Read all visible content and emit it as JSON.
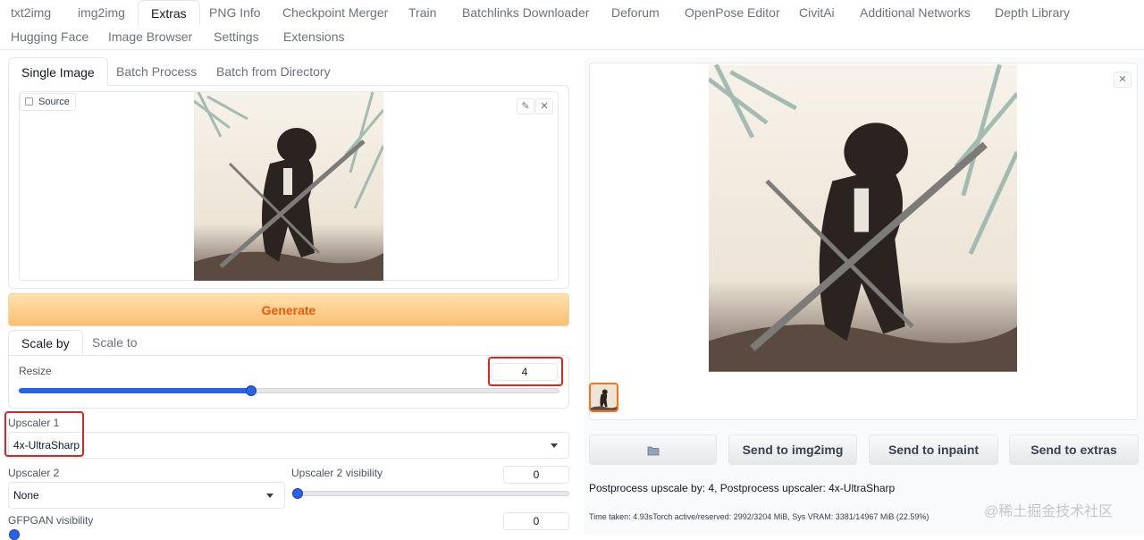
{
  "top_tabs": {
    "row1": [
      "txt2img",
      "img2img",
      "Extras",
      "PNG Info",
      "Checkpoint Merger",
      "Train",
      "Batchlinks Downloader",
      "Deforum",
      "OpenPose Editor",
      "CivitAi",
      "Additional Networks",
      "Depth Library"
    ],
    "row2": [
      "Hugging Face",
      "Image Browser",
      "Settings",
      "Extensions"
    ],
    "active": "Extras"
  },
  "panel_tabs": [
    "Single Image",
    "Batch Process",
    "Batch from Directory"
  ],
  "source": {
    "label": "Source"
  },
  "generate_label": "Generate",
  "scale_tabs": [
    "Scale by",
    "Scale to"
  ],
  "resize": {
    "label": "Resize",
    "value": "4",
    "slider_fraction": 0.43
  },
  "upscaler1": {
    "label": "Upscaler 1",
    "value": "4x-UltraSharp"
  },
  "upscaler2": {
    "label": "Upscaler 2",
    "value": "None"
  },
  "upscaler2_visibility": {
    "label": "Upscaler 2 visibility",
    "value": "0",
    "slider_fraction": 0.0
  },
  "gfpgan": {
    "label": "GFPGAN visibility",
    "value": "0"
  },
  "output_actions": {
    "folder_icon": "folder-icon",
    "send_img2img": "Send to img2img",
    "send_inpaint": "Send to inpaint",
    "send_extras": "Send to extras"
  },
  "info": {
    "postprocess": "Postprocess upscale by: 4, Postprocess upscaler: 4x-UltraSharp",
    "time_taken": "Time taken: 4.93sTorch active/reserved: 2992/3204 MiB, Sys VRAM: 3381/14967 MiB (22.59%)"
  },
  "watermark": "@稀土掘金技术社区",
  "colors": {
    "accent": "#2563eb",
    "generate": "#ea580c",
    "highlight": "#dc2626",
    "thumb_border": "#f97316"
  }
}
